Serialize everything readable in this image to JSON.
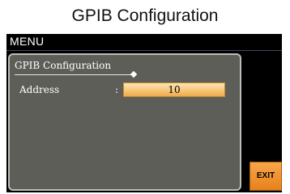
{
  "page": {
    "title": "GPIB Configuration"
  },
  "menu": {
    "label": "MENU"
  },
  "panel": {
    "title": "GPIB Configuration",
    "fields": [
      {
        "label": "Address",
        "separator": ":",
        "value": "10"
      }
    ]
  },
  "softkeys": {
    "exit_label": "EXIT"
  }
}
